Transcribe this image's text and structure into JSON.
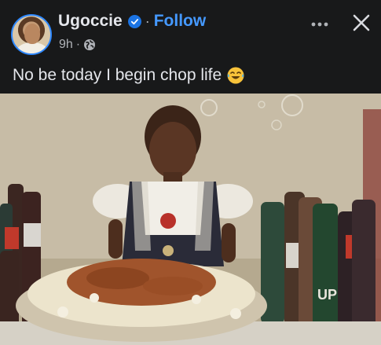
{
  "post": {
    "author": "Ugoccie",
    "follow_label": "Follow",
    "dot": "·",
    "time": "9h",
    "caption": "No be today I begin chop life",
    "caption_emoji": "laughing-crying-emoji",
    "photo_labels": {
      "bottle_label_1": "UP"
    }
  },
  "icons": {
    "verified": "verified-badge-icon",
    "globe": "globe-icon",
    "more": "more-options-icon",
    "close": "close-icon"
  },
  "colors": {
    "background": "#18191a",
    "text": "#e4e6eb",
    "secondary_text": "#b0b3b8",
    "link": "#4599ff",
    "verified": "#1b74e4"
  }
}
